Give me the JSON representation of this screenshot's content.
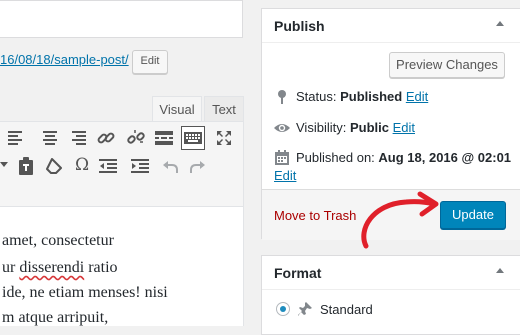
{
  "editor": {
    "permalink_text": "16/08/18/sample-post/",
    "edit_label": "Edit",
    "tabs": {
      "visual": "Visual",
      "text": "Text"
    },
    "content_lines": [
      {
        "before": "amet, consectetur",
        "misspelled": "",
        "after": ""
      },
      {
        "before": "ur ",
        "misspelled": "disserendi",
        "after": " ratio"
      },
      {
        "before": "ide, ne etiam menses! nisi",
        "misspelled": "",
        "after": ""
      },
      {
        "before": "m atque arripuit,",
        "misspelled": "",
        "after": ""
      }
    ]
  },
  "publish": {
    "title": "Publish",
    "preview_label": "Preview Changes",
    "status_label": "Status: ",
    "status_value": "Published",
    "status_edit": "Edit",
    "visibility_label": "Visibility: ",
    "visibility_value": "Public",
    "visibility_edit": "Edit",
    "published_label": "Published on: ",
    "published_value": "Aug 18, 2016 @ 02:01",
    "published_edit": "Edit",
    "trash_label": "Move to Trash",
    "update_label": "Update"
  },
  "format": {
    "title": "Format",
    "selected_option": "Standard"
  },
  "colors": {
    "accent": "#0085ba",
    "link": "#0073aa",
    "trash": "#a00",
    "annotation_arrow": "#e0202a"
  }
}
